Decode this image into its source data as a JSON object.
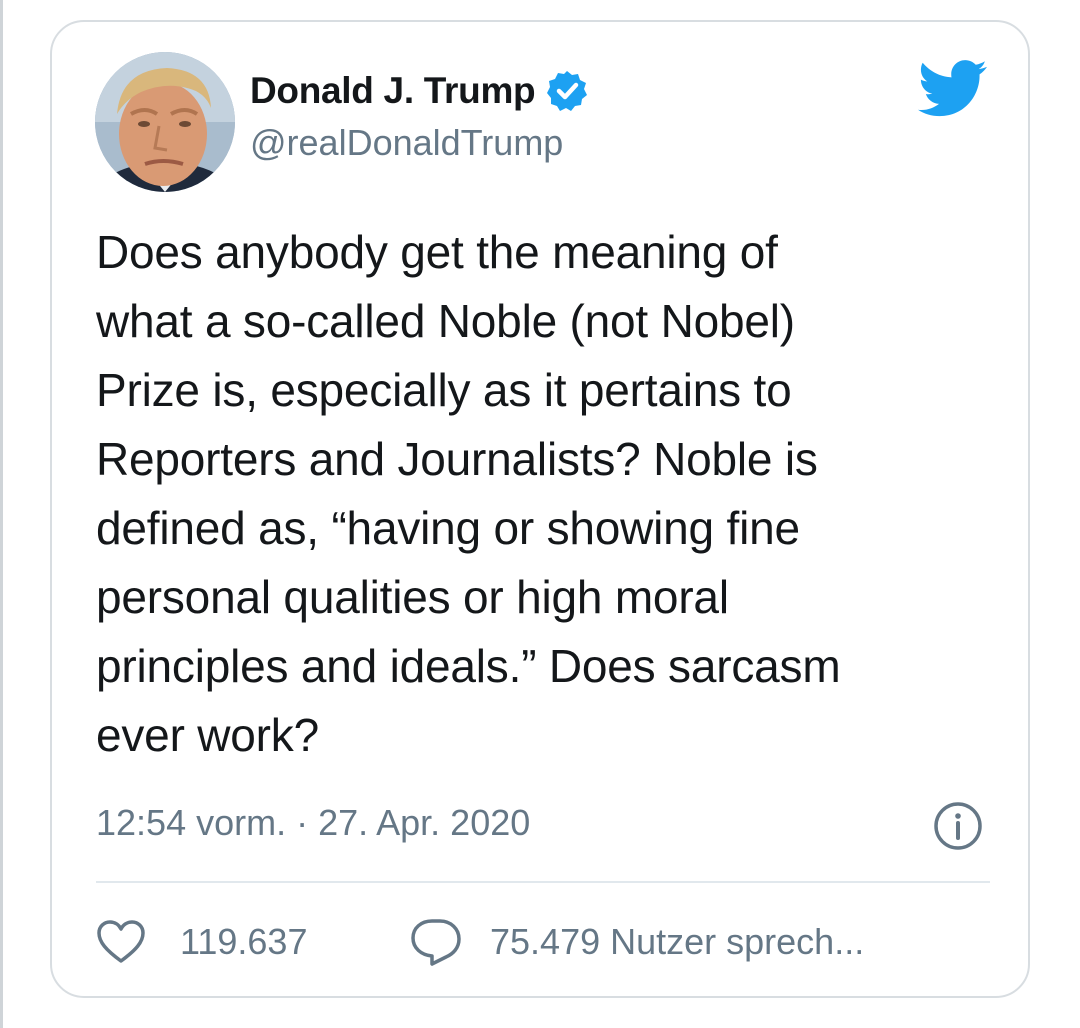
{
  "tweet": {
    "author": {
      "display_name": "Donald J. Trump",
      "handle": "@realDonaldTrump",
      "verified": true,
      "avatar_icon": "profile-photo-avatar"
    },
    "text_lines": [
      "Does anybody get the meaning of",
      "what a so-called Noble (not Nobel)",
      "Prize is, especially as it pertains to",
      "Reporters and Journalists? Noble is",
      "defined as, “having or showing fine",
      "personal qualities or high moral",
      "principles and ideals.” Does sarcasm",
      "ever work?"
    ],
    "timestamp": "12:54 vorm. · 27. Apr. 2020",
    "likes_count": "119.637",
    "replies_text": "75.479 Nutzer sprech..."
  },
  "icons": {
    "verified": "verified-badge-icon",
    "brand": "twitter-bird-icon",
    "info": "info-icon",
    "like": "heart-icon",
    "reply": "speech-bubble-icon"
  },
  "colors": {
    "twitter_blue": "#1da1f2",
    "text_primary": "#14171a",
    "text_secondary": "#657786",
    "border": "#d8dde1"
  }
}
